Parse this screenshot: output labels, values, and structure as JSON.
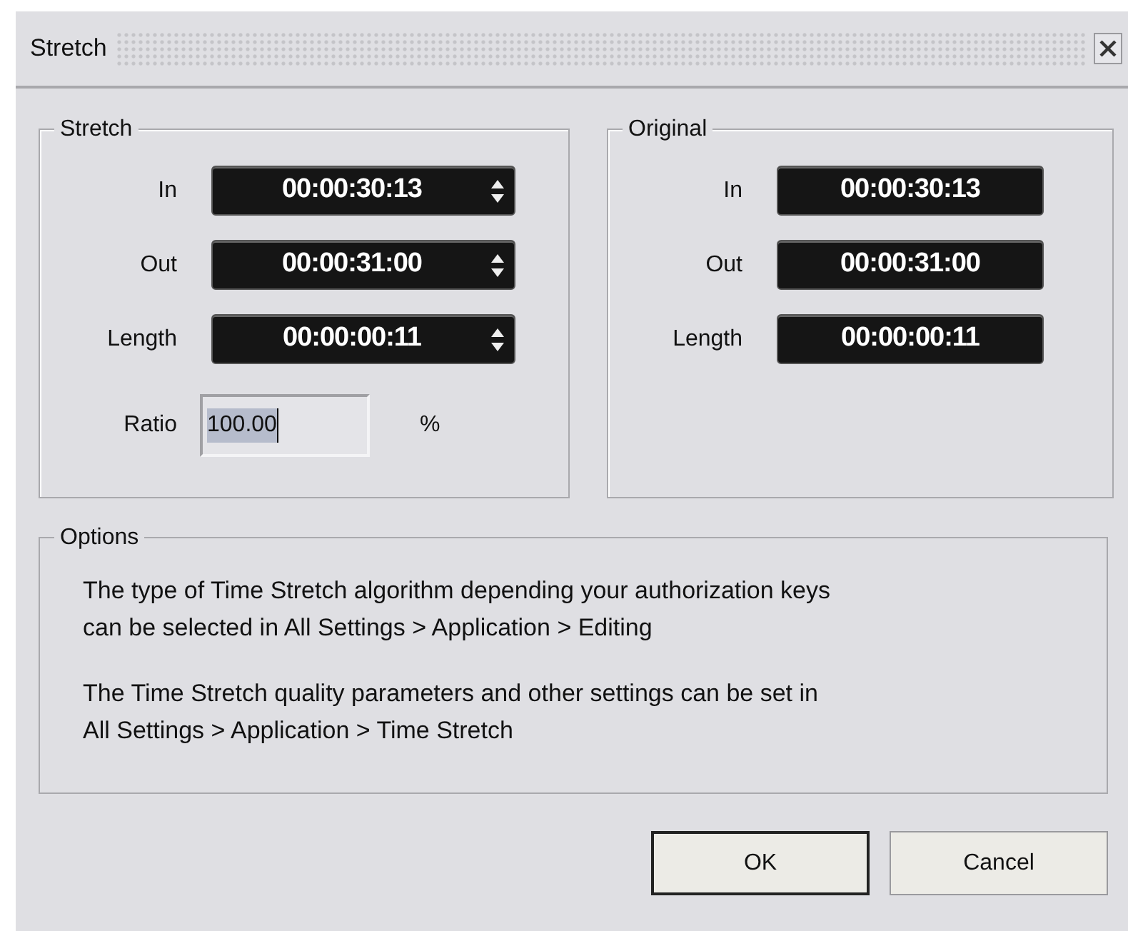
{
  "window": {
    "title": "Stretch"
  },
  "stretch": {
    "label": "Stretch",
    "fields": [
      {
        "label": "In",
        "value": "00:00:30:13",
        "spinner": true
      },
      {
        "label": "Out",
        "value": "00:00:31:00",
        "spinner": true
      },
      {
        "label": "Length",
        "value": "00:00:00:11",
        "spinner": true
      }
    ],
    "ratio": {
      "label": "Ratio",
      "value": "100.00",
      "unit": "%",
      "text_selected": true
    }
  },
  "original": {
    "label": "Original",
    "fields": [
      {
        "label": "In",
        "value": "00:00:30:13",
        "spinner": false
      },
      {
        "label": "Out",
        "value": "00:00:31:00",
        "spinner": false
      },
      {
        "label": "Length",
        "value": "00:00:00:11",
        "spinner": false
      }
    ]
  },
  "options": {
    "label": "Options",
    "paragraphs": [
      "The type of Time Stretch algorithm depending your authorization keys\ncan be selected in All Settings > Application > Editing",
      "The Time Stretch quality parameters and other settings can be set in\nAll Settings > Application > Time Stretch"
    ]
  },
  "buttons": [
    {
      "label": "OK",
      "default": true
    },
    {
      "label": "Cancel",
      "default": false
    }
  ]
}
